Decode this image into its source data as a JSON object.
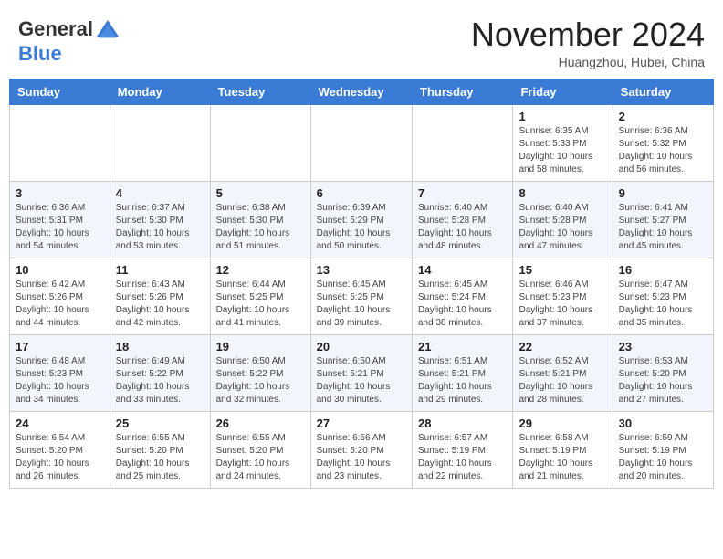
{
  "header": {
    "logo_general": "General",
    "logo_blue": "Blue",
    "month_title": "November 2024",
    "location": "Huangzhou, Hubei, China"
  },
  "weekdays": [
    "Sunday",
    "Monday",
    "Tuesday",
    "Wednesday",
    "Thursday",
    "Friday",
    "Saturday"
  ],
  "weeks": [
    [
      {
        "day": "",
        "info": ""
      },
      {
        "day": "",
        "info": ""
      },
      {
        "day": "",
        "info": ""
      },
      {
        "day": "",
        "info": ""
      },
      {
        "day": "",
        "info": ""
      },
      {
        "day": "1",
        "info": "Sunrise: 6:35 AM\nSunset: 5:33 PM\nDaylight: 10 hours and 58 minutes."
      },
      {
        "day": "2",
        "info": "Sunrise: 6:36 AM\nSunset: 5:32 PM\nDaylight: 10 hours and 56 minutes."
      }
    ],
    [
      {
        "day": "3",
        "info": "Sunrise: 6:36 AM\nSunset: 5:31 PM\nDaylight: 10 hours and 54 minutes."
      },
      {
        "day": "4",
        "info": "Sunrise: 6:37 AM\nSunset: 5:30 PM\nDaylight: 10 hours and 53 minutes."
      },
      {
        "day": "5",
        "info": "Sunrise: 6:38 AM\nSunset: 5:30 PM\nDaylight: 10 hours and 51 minutes."
      },
      {
        "day": "6",
        "info": "Sunrise: 6:39 AM\nSunset: 5:29 PM\nDaylight: 10 hours and 50 minutes."
      },
      {
        "day": "7",
        "info": "Sunrise: 6:40 AM\nSunset: 5:28 PM\nDaylight: 10 hours and 48 minutes."
      },
      {
        "day": "8",
        "info": "Sunrise: 6:40 AM\nSunset: 5:28 PM\nDaylight: 10 hours and 47 minutes."
      },
      {
        "day": "9",
        "info": "Sunrise: 6:41 AM\nSunset: 5:27 PM\nDaylight: 10 hours and 45 minutes."
      }
    ],
    [
      {
        "day": "10",
        "info": "Sunrise: 6:42 AM\nSunset: 5:26 PM\nDaylight: 10 hours and 44 minutes."
      },
      {
        "day": "11",
        "info": "Sunrise: 6:43 AM\nSunset: 5:26 PM\nDaylight: 10 hours and 42 minutes."
      },
      {
        "day": "12",
        "info": "Sunrise: 6:44 AM\nSunset: 5:25 PM\nDaylight: 10 hours and 41 minutes."
      },
      {
        "day": "13",
        "info": "Sunrise: 6:45 AM\nSunset: 5:25 PM\nDaylight: 10 hours and 39 minutes."
      },
      {
        "day": "14",
        "info": "Sunrise: 6:45 AM\nSunset: 5:24 PM\nDaylight: 10 hours and 38 minutes."
      },
      {
        "day": "15",
        "info": "Sunrise: 6:46 AM\nSunset: 5:23 PM\nDaylight: 10 hours and 37 minutes."
      },
      {
        "day": "16",
        "info": "Sunrise: 6:47 AM\nSunset: 5:23 PM\nDaylight: 10 hours and 35 minutes."
      }
    ],
    [
      {
        "day": "17",
        "info": "Sunrise: 6:48 AM\nSunset: 5:23 PM\nDaylight: 10 hours and 34 minutes."
      },
      {
        "day": "18",
        "info": "Sunrise: 6:49 AM\nSunset: 5:22 PM\nDaylight: 10 hours and 33 minutes."
      },
      {
        "day": "19",
        "info": "Sunrise: 6:50 AM\nSunset: 5:22 PM\nDaylight: 10 hours and 32 minutes."
      },
      {
        "day": "20",
        "info": "Sunrise: 6:50 AM\nSunset: 5:21 PM\nDaylight: 10 hours and 30 minutes."
      },
      {
        "day": "21",
        "info": "Sunrise: 6:51 AM\nSunset: 5:21 PM\nDaylight: 10 hours and 29 minutes."
      },
      {
        "day": "22",
        "info": "Sunrise: 6:52 AM\nSunset: 5:21 PM\nDaylight: 10 hours and 28 minutes."
      },
      {
        "day": "23",
        "info": "Sunrise: 6:53 AM\nSunset: 5:20 PM\nDaylight: 10 hours and 27 minutes."
      }
    ],
    [
      {
        "day": "24",
        "info": "Sunrise: 6:54 AM\nSunset: 5:20 PM\nDaylight: 10 hours and 26 minutes."
      },
      {
        "day": "25",
        "info": "Sunrise: 6:55 AM\nSunset: 5:20 PM\nDaylight: 10 hours and 25 minutes."
      },
      {
        "day": "26",
        "info": "Sunrise: 6:55 AM\nSunset: 5:20 PM\nDaylight: 10 hours and 24 minutes."
      },
      {
        "day": "27",
        "info": "Sunrise: 6:56 AM\nSunset: 5:20 PM\nDaylight: 10 hours and 23 minutes."
      },
      {
        "day": "28",
        "info": "Sunrise: 6:57 AM\nSunset: 5:19 PM\nDaylight: 10 hours and 22 minutes."
      },
      {
        "day": "29",
        "info": "Sunrise: 6:58 AM\nSunset: 5:19 PM\nDaylight: 10 hours and 21 minutes."
      },
      {
        "day": "30",
        "info": "Sunrise: 6:59 AM\nSunset: 5:19 PM\nDaylight: 10 hours and 20 minutes."
      }
    ]
  ]
}
